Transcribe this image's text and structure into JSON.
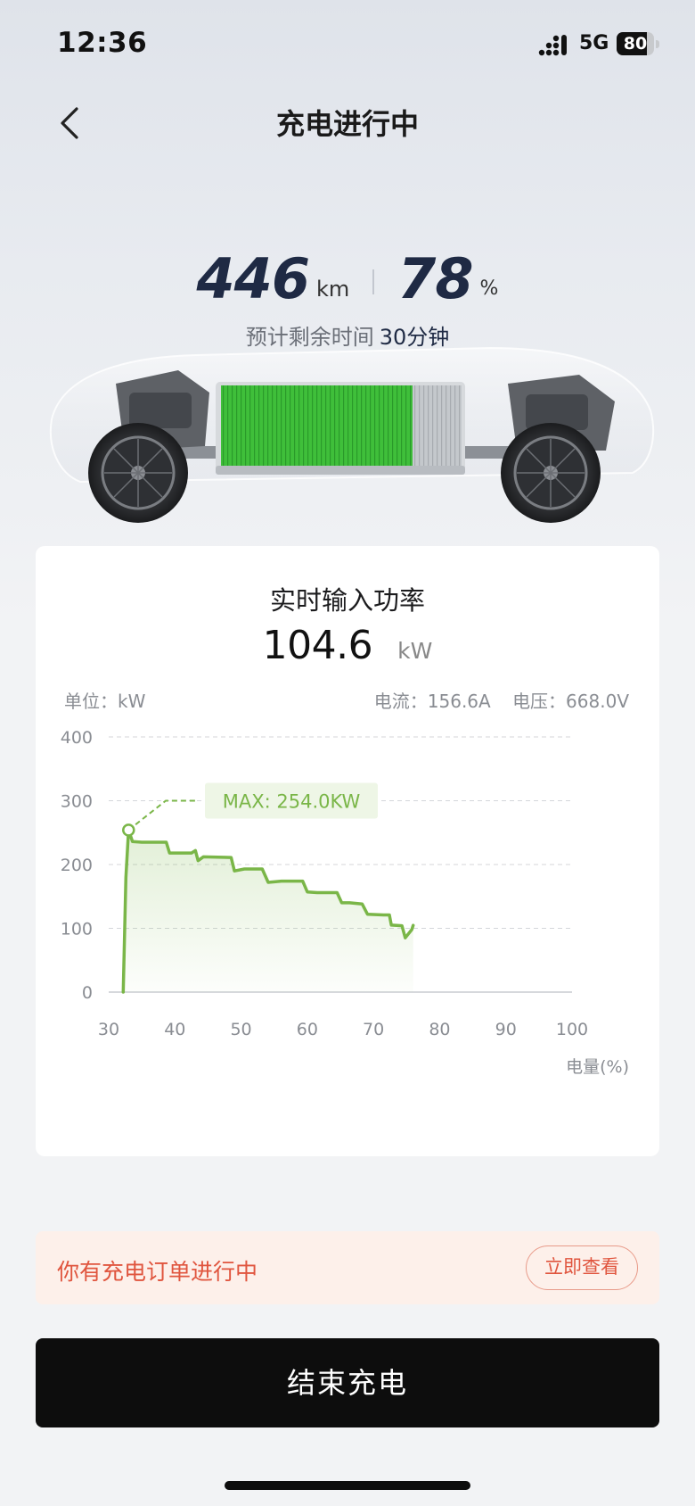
{
  "status_bar": {
    "time": "12:36",
    "network": "5G",
    "battery_level": 80,
    "battery_text": "80"
  },
  "nav": {
    "title": "充电进行中",
    "back_icon": "chevron-left-icon"
  },
  "summary": {
    "range_value": "446",
    "range_unit": "km",
    "soc_value": "78",
    "soc_unit": "%",
    "eta_label": "预计剩余时间",
    "eta_value": "30分钟"
  },
  "power_card": {
    "title": "实时输入功率",
    "power_value": "104.6",
    "power_unit": "kW",
    "unit_label": "单位：kW",
    "current": "电流：156.6A",
    "voltage": "电压：668.0V"
  },
  "chart_data": {
    "type": "area",
    "x_unit_label": "电量(%)",
    "xlim": [
      30,
      100
    ],
    "ylim": [
      0,
      400
    ],
    "x_ticks": [
      "30",
      "40",
      "50",
      "60",
      "70",
      "80",
      "90",
      "100"
    ],
    "y_ticks": [
      "0",
      "100",
      "200",
      "300",
      "400"
    ],
    "grid": true,
    "max_label": "MAX: 254.0KW",
    "max_point": {
      "x": 33,
      "y": 254
    },
    "series": [
      {
        "color": "#7ab648",
        "points": [
          [
            32.2,
            0
          ],
          [
            32.6,
            180
          ],
          [
            33.0,
            254
          ],
          [
            33.6,
            236
          ],
          [
            35,
            235
          ],
          [
            38.7,
            235
          ],
          [
            39.2,
            218
          ],
          [
            42.5,
            218
          ],
          [
            43.1,
            222
          ],
          [
            43.5,
            206
          ],
          [
            44.3,
            212
          ],
          [
            48.5,
            211
          ],
          [
            49.0,
            190
          ],
          [
            50.5,
            193
          ],
          [
            53.2,
            193
          ],
          [
            54.1,
            172
          ],
          [
            56.1,
            174
          ],
          [
            59.3,
            174
          ],
          [
            60.0,
            157
          ],
          [
            61.5,
            156
          ],
          [
            64.5,
            156
          ],
          [
            65.2,
            140
          ],
          [
            66.4,
            140
          ],
          [
            68.3,
            138
          ],
          [
            69.1,
            122
          ],
          [
            71.5,
            121
          ],
          [
            72.4,
            121
          ],
          [
            72.7,
            105
          ],
          [
            74.3,
            104
          ],
          [
            74.8,
            85
          ],
          [
            75.8,
            98
          ],
          [
            76.0,
            104.6
          ]
        ]
      }
    ]
  },
  "order_banner": {
    "text": "你有充电订单进行中",
    "button": "立即查看"
  },
  "actions": {
    "end_charging": "结束充电"
  },
  "colors": {
    "accent_green": "#7ab648",
    "alert_red": "#e0553e",
    "dark_navy": "#1f2a44"
  }
}
